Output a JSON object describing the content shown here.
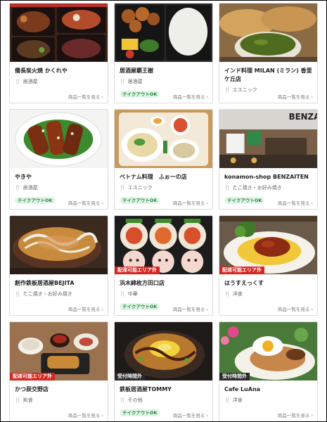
{
  "more_label": "商品一覧を見る",
  "takeout_label": "テイクアウトOK",
  "cards": [
    {
      "name": "備長炭火焼 かくれや",
      "category": "居酒屋",
      "takeout": false,
      "badge": ""
    },
    {
      "name": "居酒屋覇王樹",
      "category": "居酒屋",
      "takeout": true,
      "badge": ""
    },
    {
      "name": "インド料理 MILAN (ミラン) 香里ケ丘店",
      "category": "エスニック",
      "takeout": false,
      "badge": ""
    },
    {
      "name": "やきや",
      "category": "居酒屋",
      "takeout": true,
      "badge": ""
    },
    {
      "name": "ベトナム料理　ふぉーの店",
      "category": "エスニック",
      "takeout": true,
      "badge": ""
    },
    {
      "name": "konamon-shop BENZAITEN",
      "category": "たこ焼き・お好み焼き",
      "takeout": true,
      "badge": ""
    },
    {
      "name": "創作鉄板居酒屋BEJITA",
      "category": "たこ焼き・お好み焼き",
      "takeout": false,
      "badge": ""
    },
    {
      "name": "浜木綿枚方田口店",
      "category": "中華",
      "takeout": true,
      "badge": "配達可能エリア外"
    },
    {
      "name": "はうすえっくす",
      "category": "洋食",
      "takeout": false,
      "badge": "配達可能エリア外"
    },
    {
      "name": "かつ辰交野店",
      "category": "和食",
      "takeout": false,
      "badge": "配達可能エリア外"
    },
    {
      "name": "鉄板居酒屋TOMMY",
      "category": "その他",
      "takeout": true,
      "badge": "受付時間外"
    },
    {
      "name": "Cafe LuAna",
      "category": "洋食",
      "takeout": false,
      "badge": "受付時間外"
    }
  ],
  "colors": {
    "accent_red": "#d7261e",
    "takeout_green": "#1f8f3f",
    "badge_dark": "#2a2a2a"
  },
  "icons": {
    "category": "fork-knife-icon",
    "more": "chevron-right-icon"
  }
}
